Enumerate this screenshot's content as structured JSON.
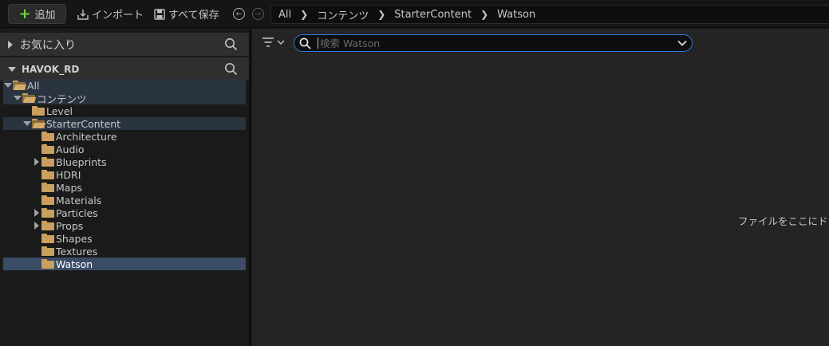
{
  "toolbar": {
    "add_label": "追加",
    "import_label": "インポート",
    "save_all_label": "すべて保存"
  },
  "breadcrumb": [
    "All",
    "コンテンツ",
    "StarterContent",
    "Watson"
  ],
  "favorites": {
    "label": "お気に入り"
  },
  "project": {
    "label": "HAVOK_RD"
  },
  "tree": [
    {
      "label": "All",
      "depth": 0,
      "expand": "open",
      "folder": "open",
      "state": "hl"
    },
    {
      "label": "コンテンツ",
      "depth": 1,
      "expand": "open",
      "folder": "open",
      "state": "hl"
    },
    {
      "label": "Level",
      "depth": 2,
      "expand": "none",
      "folder": "closed",
      "state": ""
    },
    {
      "label": "StarterContent",
      "depth": 2,
      "expand": "open",
      "folder": "open",
      "state": "hl"
    },
    {
      "label": "Architecture",
      "depth": 3,
      "expand": "none",
      "folder": "closed",
      "state": ""
    },
    {
      "label": "Audio",
      "depth": 3,
      "expand": "none",
      "folder": "closed",
      "state": ""
    },
    {
      "label": "Blueprints",
      "depth": 3,
      "expand": "closed",
      "folder": "closed",
      "state": ""
    },
    {
      "label": "HDRI",
      "depth": 3,
      "expand": "none",
      "folder": "closed",
      "state": ""
    },
    {
      "label": "Maps",
      "depth": 3,
      "expand": "none",
      "folder": "closed",
      "state": ""
    },
    {
      "label": "Materials",
      "depth": 3,
      "expand": "none",
      "folder": "closed",
      "state": ""
    },
    {
      "label": "Particles",
      "depth": 3,
      "expand": "closed",
      "folder": "closed",
      "state": ""
    },
    {
      "label": "Props",
      "depth": 3,
      "expand": "closed",
      "folder": "closed",
      "state": ""
    },
    {
      "label": "Shapes",
      "depth": 3,
      "expand": "none",
      "folder": "closed",
      "state": ""
    },
    {
      "label": "Textures",
      "depth": 3,
      "expand": "none",
      "folder": "closed",
      "state": ""
    },
    {
      "label": "Watson",
      "depth": 3,
      "expand": "none",
      "folder": "closed",
      "state": "sel"
    }
  ],
  "search": {
    "placeholder": "検索 Watson",
    "value": ""
  },
  "drop_hint": "ファイルをここにドロ",
  "colors": {
    "accent": "#2c7ad6",
    "add_icon": "#6fce3d",
    "folder": "#c9a060",
    "selection": "#3a4c66"
  }
}
